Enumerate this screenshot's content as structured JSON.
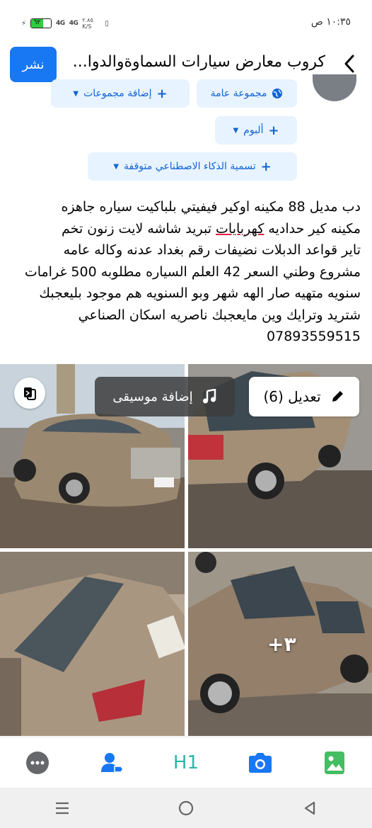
{
  "status_bar": {
    "time": "١٠:٣٥ ص",
    "battery_level": "٦٢",
    "signal_1": "4G",
    "signal_2": "4G",
    "speed": "٢.٨٥ K/S"
  },
  "header": {
    "title": "كروب معارض سيارات السماوةوالدوا...",
    "publish_label": "نشر"
  },
  "chips": {
    "public_group": "مجموعة عامة",
    "add_groups": "إضافة مجموعات",
    "album": "ألبوم",
    "ai_label": "تسمية الذكاء الاصطناعي متوقفة"
  },
  "post": {
    "line1": "دب مديل 88 مكينه اوكير فيفيتي بلباكيت سياره جاهزه",
    "line2_a": "مكينه كير حداديه ",
    "line2_b": "كهربايات",
    "line2_c": " تبريد شاشه لايت زنون تخم",
    "line3": "تاير قواعد الدبلات نضيفات رقم بغداد عدنه وكاله عامه",
    "line4": "مشروع وطني السعر 42 العلم السياره مطلوبه 500 غرامات",
    "line5": "سنويه متهيه صار الهه شهر وبو السنويه هم موجود بليعجبك",
    "line6": "شتريد وترايك وين مايعجبك ناصريه اسكان الصناعي",
    "line7": "07893559515"
  },
  "photos": {
    "more_count": "+٣",
    "edit_label": "تعديل (6)",
    "music_label": "إضافة موسيقى"
  },
  "toolbar": {
    "h1_label": "H1"
  },
  "colors": {
    "accent": "#1877f2",
    "chip_bg": "#e7f3ff",
    "chip_text": "#1263d4",
    "h1": "#2bb7a7",
    "photo_icon": "#45bd62"
  }
}
